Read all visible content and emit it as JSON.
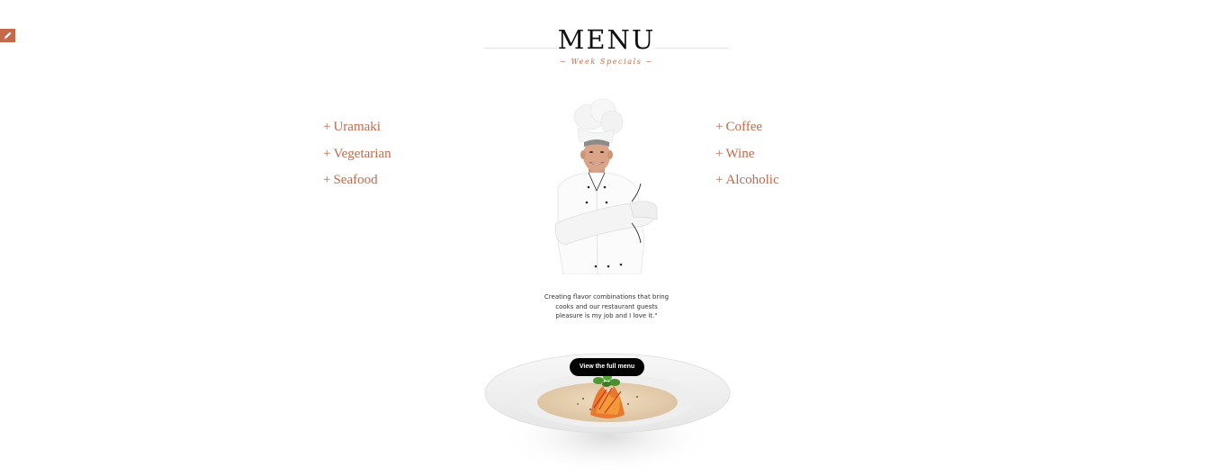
{
  "header": {
    "title": "MENU",
    "subtitle": "~ Week Specials ~"
  },
  "categories_left": [
    {
      "plus": "+",
      "label": "Uramaki"
    },
    {
      "plus": "+",
      "label": "Vegetarian"
    },
    {
      "plus": "+",
      "label": "Seafood"
    }
  ],
  "categories_right": [
    {
      "plus": "+",
      "label": "Coffee"
    },
    {
      "plus": "+",
      "label": "Wine"
    },
    {
      "plus": "+",
      "label": "Alcoholic"
    }
  ],
  "chef": {
    "quote": "Creating flavor combinations that bring cooks and our restaurant guests pleasure is my job and I love it.\""
  },
  "cta": {
    "label": "View the full menu"
  },
  "colors": {
    "accent": "#c4694a",
    "title": "#111111",
    "button_bg": "#000000"
  },
  "icons": {
    "edit": "pencil-icon"
  }
}
